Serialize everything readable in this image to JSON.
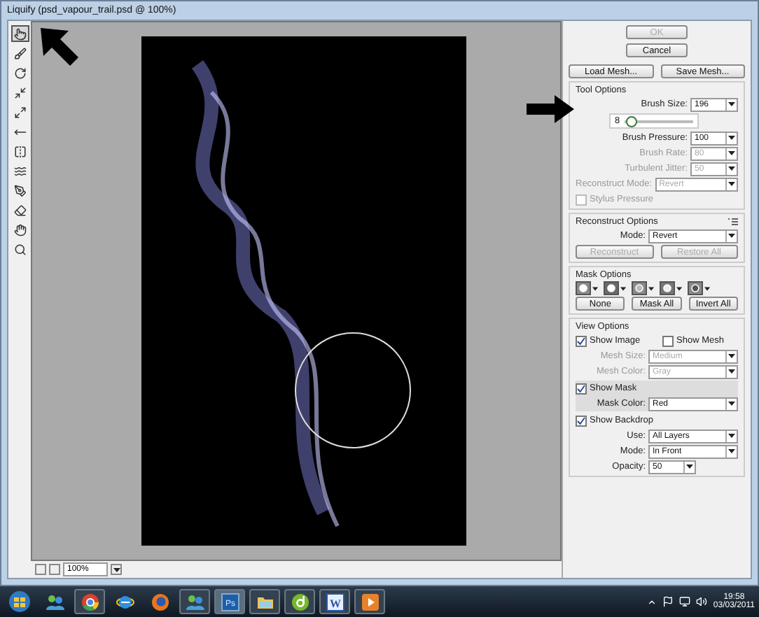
{
  "window": {
    "title": "Liquify (psd_vapour_trail.psd @ 100%)"
  },
  "tools": [
    {
      "kind": "warp",
      "selected": true
    },
    {
      "kind": "reconstruct",
      "selected": false
    },
    {
      "kind": "twirl",
      "selected": false
    },
    {
      "kind": "pucker",
      "selected": false
    },
    {
      "kind": "bloat",
      "selected": false
    },
    {
      "kind": "push",
      "selected": false
    },
    {
      "kind": "mirror",
      "selected": false
    },
    {
      "kind": "turbulence",
      "selected": false
    },
    {
      "kind": "freeze",
      "selected": false
    },
    {
      "kind": "thaw",
      "selected": false
    },
    {
      "kind": "hand",
      "selected": false
    },
    {
      "kind": "zoom",
      "selected": false
    }
  ],
  "dialog_buttons": [
    {
      "label": "OK",
      "disabled": true
    },
    {
      "label": "Cancel",
      "disabled": false
    }
  ],
  "mesh_buttons": [
    {
      "label": "Load Mesh...",
      "disabled": false
    },
    {
      "label": "Save Mesh...",
      "disabled": false
    }
  ],
  "tool_options": {
    "title": "Tool Options",
    "fields": [
      {
        "kind": "combo",
        "label": "Brush Size:",
        "value": "196",
        "disabled": false
      },
      {
        "kind": "slider",
        "min": "8",
        "level": 0.08
      },
      {
        "kind": "combo",
        "label": "Brush Pressure:",
        "value": "100",
        "disabled": false
      },
      {
        "kind": "combo",
        "label": "Brush Rate:",
        "value": "80",
        "disabled": true
      },
      {
        "kind": "combo",
        "label": "Turbulent Jitter:",
        "value": "50",
        "disabled": true
      },
      {
        "kind": "select",
        "label": "Reconstruct Mode:",
        "value": "Revert",
        "disabled": true
      },
      {
        "kind": "checkbox",
        "label": "Stylus Pressure",
        "checked": false,
        "disabled": true
      }
    ]
  },
  "reconstruct_options": {
    "title": "Reconstruct Options",
    "mode_label": "Mode:",
    "mode": "Revert",
    "buttons": [
      {
        "label": "Reconstruct",
        "disabled": true
      },
      {
        "label": "Restore All",
        "disabled": true
      }
    ]
  },
  "mask_options": {
    "title": "Mask Options",
    "modes": [
      {
        "kind": "replace"
      },
      {
        "kind": "add"
      },
      {
        "kind": "subtract"
      },
      {
        "kind": "intersect"
      },
      {
        "kind": "invert"
      }
    ],
    "buttons": [
      {
        "label": "None",
        "disabled": false
      },
      {
        "label": "Mask All",
        "disabled": false
      },
      {
        "label": "Invert All",
        "disabled": false
      }
    ]
  },
  "view_options": {
    "title": "View Options",
    "show_image": {
      "label": "Show Image",
      "checked": true
    },
    "show_mesh": {
      "label": "Show Mesh",
      "checked": false
    },
    "mesh_fields": [
      {
        "label": "Mesh Size:",
        "value": "Medium",
        "disabled": true
      },
      {
        "label": "Mesh Color:",
        "value": "Gray",
        "disabled": true
      }
    ],
    "show_mask": {
      "label": "Show Mask",
      "checked": true
    },
    "mask_color": {
      "label": "Mask Color:",
      "value": "Red",
      "disabled": false
    },
    "show_backdrop": {
      "label": "Show Backdrop",
      "checked": true
    },
    "backdrop_fields": [
      {
        "kind": "select",
        "label": "Use:",
        "value": "All Layers",
        "disabled": false
      },
      {
        "kind": "select",
        "label": "Mode:",
        "value": "In Front",
        "disabled": false
      },
      {
        "kind": "combo",
        "label": "Opacity:",
        "value": "50",
        "disabled": false
      }
    ]
  },
  "zoom": {
    "value": "100%"
  },
  "taskbar": {
    "items": [
      {
        "kind": "start",
        "running": false,
        "selected": false
      },
      {
        "kind": "messenger",
        "running": false,
        "selected": false
      },
      {
        "kind": "chrome",
        "running": true,
        "selected": false
      },
      {
        "kind": "ie",
        "running": false,
        "selected": false
      },
      {
        "kind": "firefox",
        "running": false,
        "selected": false
      },
      {
        "kind": "messenger",
        "running": true,
        "selected": false
      },
      {
        "kind": "photoshop",
        "label": "Ps",
        "running": true,
        "selected": true
      },
      {
        "kind": "folder",
        "running": true,
        "selected": false
      },
      {
        "kind": "dreamweaver",
        "running": true,
        "selected": false
      },
      {
        "kind": "word",
        "label": "W",
        "running": true,
        "selected": false
      },
      {
        "kind": "media",
        "running": true,
        "selected": false
      }
    ],
    "time": "19:58",
    "date": "03/03/2011"
  }
}
